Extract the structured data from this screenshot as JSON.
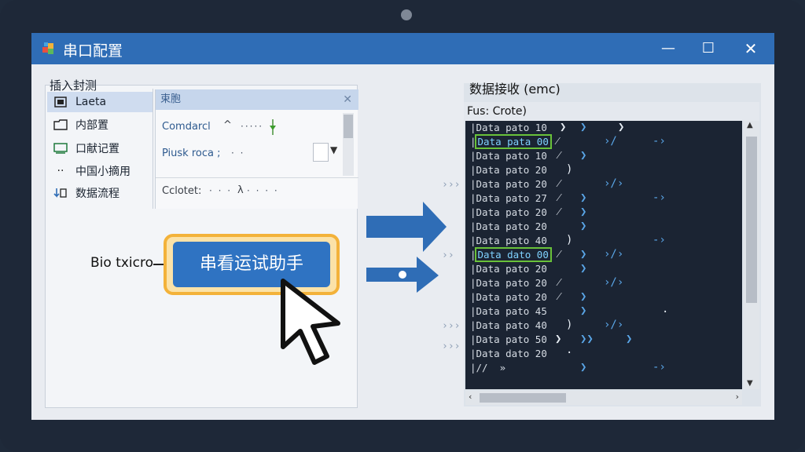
{
  "window": {
    "title": "串口配置",
    "min_icon": "—",
    "max_icon": "☐",
    "close_icon": "✕"
  },
  "left": {
    "heading": "插入封测",
    "nav": [
      {
        "icon": "grid-icon",
        "label": "Laeta",
        "selected": true
      },
      {
        "icon": "folder-icon",
        "label": "内部置",
        "selected": false
      },
      {
        "icon": "monitor-icon",
        "label": "口献记置",
        "selected": false
      },
      {
        "icon": "dot-icon",
        "label": "中国小摘用",
        "selected": false
      },
      {
        "icon": "flow-icon",
        "label": "数据流程",
        "selected": false
      }
    ],
    "props": {
      "header": "束胞",
      "close": "✕",
      "row1_label": "Comdarcl",
      "row1_caret": "^",
      "row2_label": "Piusk roca ;",
      "row3_label": "Cclotet:",
      "row3_mark": "λ"
    },
    "bio_label": "Bio txicro",
    "main_button": "串看运试助手"
  },
  "right": {
    "heading": "数据接收 (emc)",
    "subheader": "Fus: Crote)",
    "lines": [
      {
        "text": "Data pato 10",
        "hl": false
      },
      {
        "text": "Data pata 00",
        "hl": true
      },
      {
        "text": "Data pato 10",
        "hl": false
      },
      {
        "text": "Data pato 20",
        "hl": false
      },
      {
        "text": "Data pato 20",
        "hl": false
      },
      {
        "text": "Data pato 27",
        "hl": false
      },
      {
        "text": "Data pato 20",
        "hl": false
      },
      {
        "text": "Data pato 20",
        "hl": false
      },
      {
        "text": "Data pato 40",
        "hl": false
      },
      {
        "text": "Data dato 00",
        "hl": true
      },
      {
        "text": "Data pato 20",
        "hl": false
      },
      {
        "text": "Data pato 20",
        "hl": false
      },
      {
        "text": "Data pato 20",
        "hl": false
      },
      {
        "text": "Data pato 45",
        "hl": false
      },
      {
        "text": "Data pato 40",
        "hl": false
      },
      {
        "text": "Data pato 50",
        "hl": false
      },
      {
        "text": "Data dato 20",
        "hl": false
      },
      {
        "text": "|//  »",
        "hl": false
      }
    ]
  },
  "colors": {
    "accent": "#2f73c2",
    "highlight": "#f3b23a",
    "terminal_bg": "#1b2433",
    "green_hl": "#69c13a"
  }
}
